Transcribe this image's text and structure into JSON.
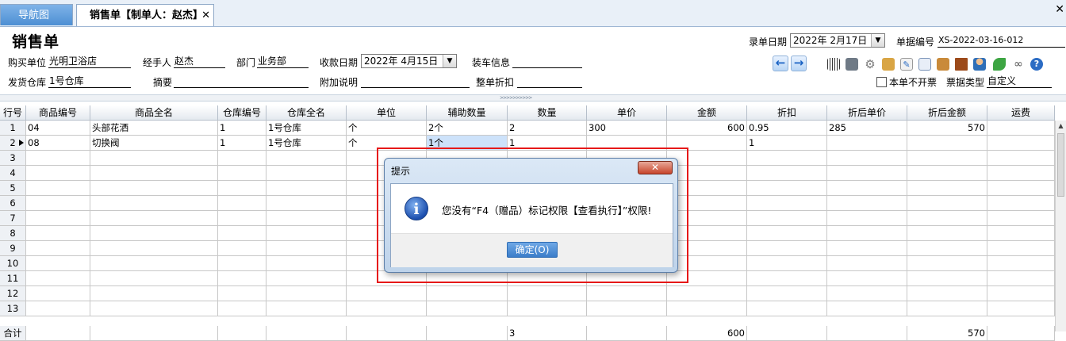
{
  "tabs": {
    "nav": "导航图",
    "sales": "销售单【制单人：赵杰】",
    "close_glyph": "✕",
    "window_close": "✕"
  },
  "form": {
    "title": "销售单",
    "buyer_label": "购买单位",
    "buyer": "光明卫浴店",
    "handler_label": "经手人",
    "handler": "赵杰",
    "dept_label": "部门",
    "dept": "业务部",
    "collect_date_label": "收款日期",
    "collect_date": "2022年 4月15日",
    "loading_label": "装车信息",
    "loading": "",
    "entry_date_label": "录单日期",
    "entry_date": "2022年 2月17日",
    "doc_no_label": "单据编号",
    "doc_no": "XS-2022-03-16-012",
    "warehouse_label": "发货仓库",
    "warehouse": "1号仓库",
    "summary_label": "摘要",
    "summary": "",
    "remark_label": "附加说明",
    "remark": "",
    "discount_label": "整单折扣",
    "discount": "",
    "no_invoice_label": "本单不开票",
    "ticket_type_label": "票据类型",
    "ticket_type": "自定义"
  },
  "toolbar": {
    "icons": [
      "barcode-icon",
      "printer-icon",
      "gear-icon",
      "cube-add-icon",
      "edit-icon",
      "export-icon",
      "box-icon",
      "door-icon",
      "user-icon",
      "leaf-icon",
      "link-icon",
      "help-icon"
    ]
  },
  "grid": {
    "headers": [
      "行号",
      "商品编号",
      "商品全名",
      "仓库编号",
      "仓库全名",
      "单位",
      "辅助数量",
      "数量",
      "单价",
      "金额",
      "折扣",
      "折后单价",
      "折后金额",
      "运费"
    ],
    "rows": [
      [
        "1",
        "04",
        "头部花洒",
        "1",
        "1号仓库",
        "个",
        "2个",
        "2",
        "300",
        "600",
        "0.95",
        "285",
        "570",
        ""
      ],
      [
        "2",
        "08",
        "切换阀",
        "1",
        "1号仓库",
        "个",
        "1个",
        "1",
        "",
        "",
        "1",
        "",
        "",
        ""
      ],
      [
        "3",
        "",
        "",
        "",
        "",
        "",
        "",
        "",
        "",
        "",
        "",
        "",
        "",
        ""
      ],
      [
        "4",
        "",
        "",
        "",
        "",
        "",
        "",
        "",
        "",
        "",
        "",
        "",
        "",
        ""
      ],
      [
        "5",
        "",
        "",
        "",
        "",
        "",
        "",
        "",
        "",
        "",
        "",
        "",
        "",
        ""
      ],
      [
        "6",
        "",
        "",
        "",
        "",
        "",
        "",
        "",
        "",
        "",
        "",
        "",
        "",
        ""
      ],
      [
        "7",
        "",
        "",
        "",
        "",
        "",
        "",
        "",
        "",
        "",
        "",
        "",
        "",
        ""
      ],
      [
        "8",
        "",
        "",
        "",
        "",
        "",
        "",
        "",
        "",
        "",
        "",
        "",
        "",
        ""
      ],
      [
        "9",
        "",
        "",
        "",
        "",
        "",
        "",
        "",
        "",
        "",
        "",
        "",
        "",
        ""
      ],
      [
        "10",
        "",
        "",
        "",
        "",
        "",
        "",
        "",
        "",
        "",
        "",
        "",
        "",
        ""
      ],
      [
        "11",
        "",
        "",
        "",
        "",
        "",
        "",
        "",
        "",
        "",
        "",
        "",
        "",
        ""
      ],
      [
        "12",
        "",
        "",
        "",
        "",
        "",
        "",
        "",
        "",
        "",
        "",
        "",
        "",
        ""
      ],
      [
        "13",
        "",
        "",
        "",
        "",
        "",
        "",
        "",
        "",
        "",
        "",
        "",
        "",
        ""
      ]
    ],
    "total": [
      "合计",
      "",
      "",
      "",
      "",
      "",
      "",
      "3",
      "",
      "600",
      "",
      "",
      "570",
      ""
    ]
  },
  "dialog": {
    "title": "提示",
    "icon": "i",
    "close_glyph": "✕",
    "message": "您没有“F4（赠品）标记权限【查看执行】”权限!",
    "ok_label": "确定(O)"
  },
  "colors": {
    "highlight": "#e61919",
    "accent": "#3b7dc9"
  }
}
